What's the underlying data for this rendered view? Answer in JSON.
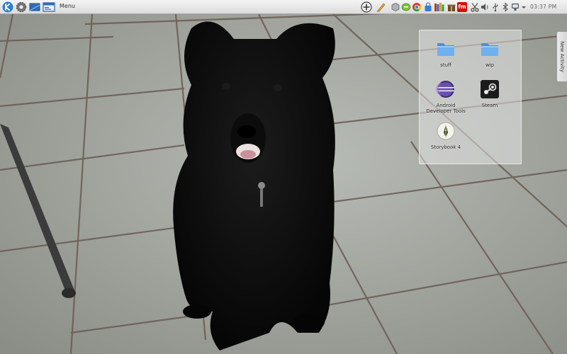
{
  "panel": {
    "launcher_icon": "kde-k-logo-icon",
    "settings_icon": "gear-icon",
    "show_desktop_icon": "desktop-icon",
    "window_icon": "window-icon",
    "menu_label": "Menu",
    "tray_icons": [
      "add-widget-icon",
      "pencil-icon",
      "cube-icon",
      "chat-icon",
      "chrome-icon",
      "bag-icon",
      "books-icon",
      "lastfm-icon",
      "scissors-icon",
      "usb-icon",
      "volume-icon",
      "bluetooth-icon",
      "network-icon",
      "chevron-down-icon"
    ],
    "lastfm_text": "fm",
    "clock": "03:37 PM"
  },
  "folder_view": {
    "items": [
      {
        "label": "stuff",
        "icon": "folder-icon"
      },
      {
        "label": "wip",
        "icon": "folder-icon"
      },
      {
        "label": "Android Developer Tools",
        "icon": "eclipse-icon"
      },
      {
        "label": "Steam",
        "icon": "steam-icon"
      },
      {
        "label": "Storybook 4",
        "icon": "storybook-icon"
      }
    ]
  },
  "activity_tab": {
    "label": "New Activity"
  },
  "colors": {
    "panel_bg": "#e8e8e8",
    "folder_blue": "#5b9bd5",
    "lastfm_red": "#d51007"
  }
}
